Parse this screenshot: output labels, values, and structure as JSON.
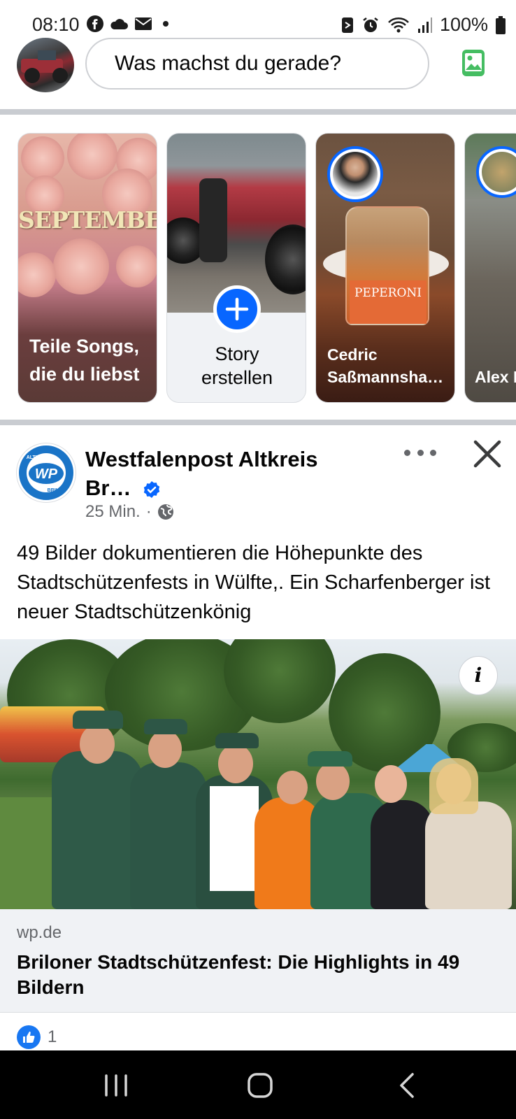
{
  "status_bar": {
    "time": "08:10",
    "battery": "100%",
    "left_icons": [
      "facebook-icon",
      "cloud-icon",
      "mail-icon",
      "dot-icon"
    ],
    "right_icons": [
      "nfc-icon",
      "alarm-icon",
      "wifi-icon",
      "signal-icon",
      "battery-icon"
    ]
  },
  "composer": {
    "placeholder": "Was machst du gerade?",
    "photo_icon": "photo-icon",
    "photo_color": "#45bd62"
  },
  "stories": {
    "items": [
      {
        "label": "Teile Songs, die du liebst",
        "headline": "SEPTEMBER"
      },
      {
        "label": "Story erstellen",
        "icon": "plus-icon"
      },
      {
        "label": "Cedric Saßmannsha…",
        "jar_text": "PEPERONI"
      },
      {
        "label": "Alex Lede"
      }
    ]
  },
  "post": {
    "page_name_line1": "Westfalenpost Altkreis",
    "page_name_line2": "Br…",
    "logo_text": "WP",
    "logo_ring_top": "ALTKREIS",
    "logo_ring_bottom": "BRILON",
    "time": "25 Min.",
    "separator": "·",
    "audience_icon": "globe-icon",
    "text": "49 Bilder dokumentieren die Höhepunkte des Stadtschützenfests in Wülfte,. Ein Scharfenberger ist neuer Stadtschützenkönig",
    "info_label": "i",
    "link": {
      "domain": "wp.de",
      "title": "Briloner Stadtschützenfest: Die Highlights in 49 Bildern"
    },
    "reactions": {
      "count": "1",
      "icon": "like-icon"
    }
  },
  "colors": {
    "accent": "#0866ff",
    "divider": "#c9ccd1",
    "secondary_text": "#65676b"
  }
}
